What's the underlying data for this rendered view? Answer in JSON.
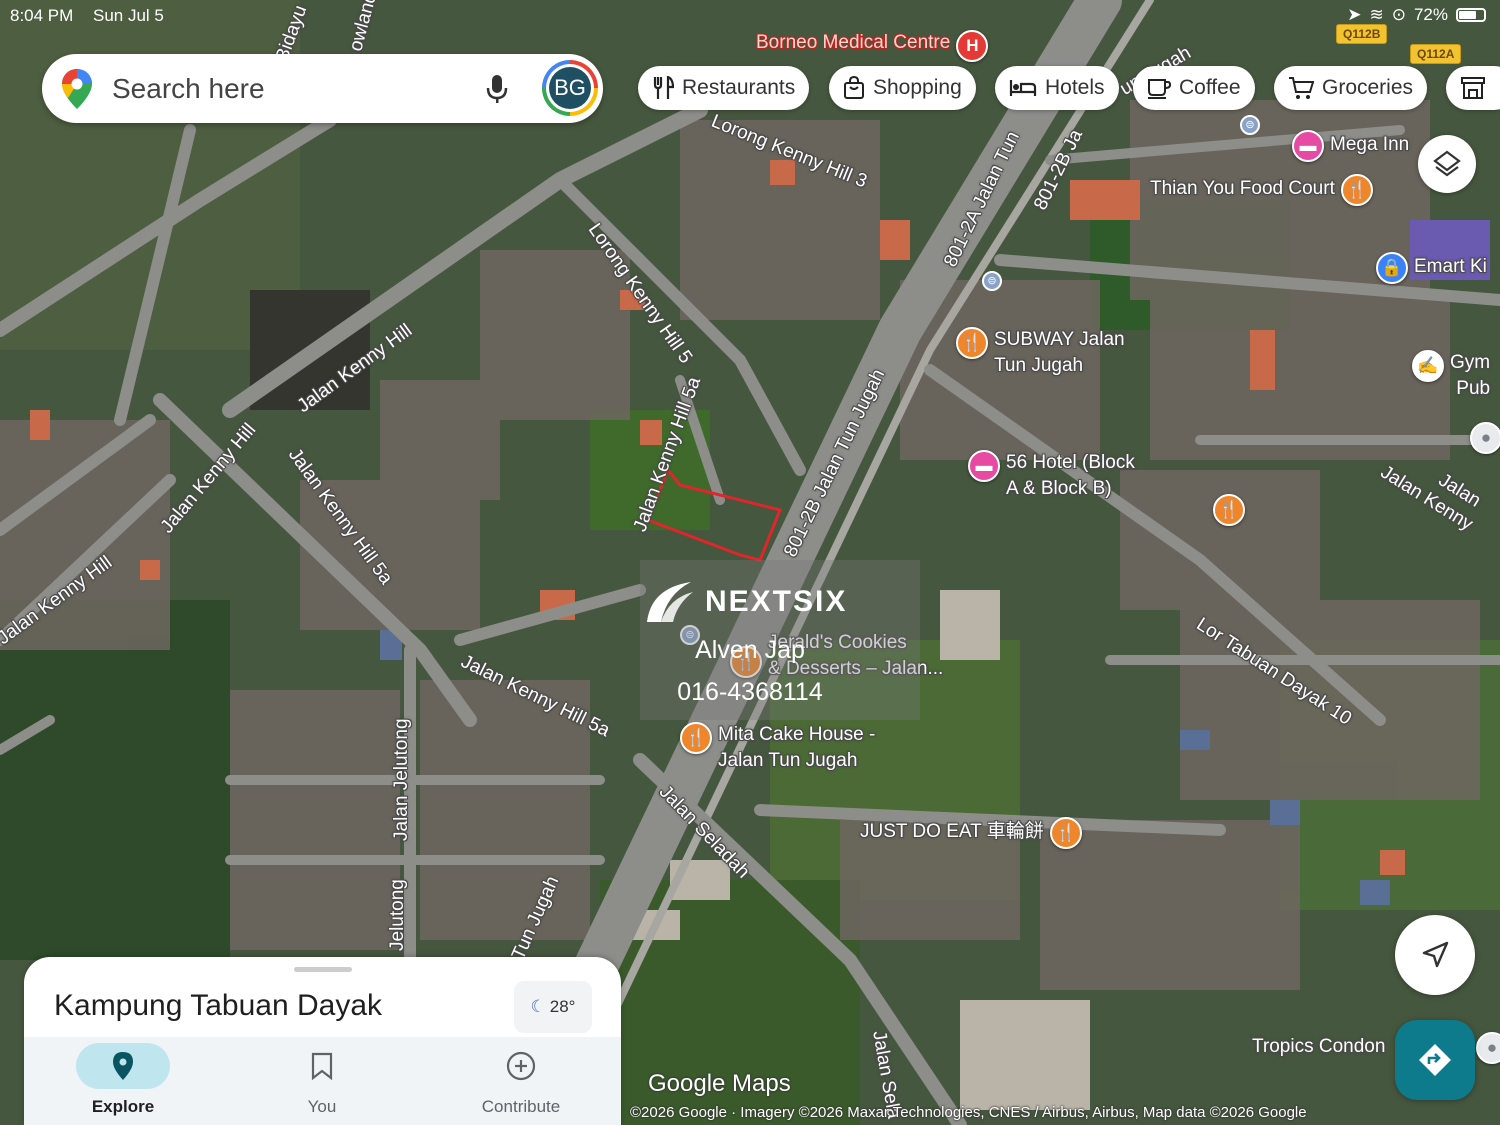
{
  "status_bar": {
    "time": "8:04 PM",
    "date": "Sun Jul 5",
    "battery": "72%"
  },
  "search": {
    "placeholder": "Search here",
    "avatar_initials": "BG"
  },
  "chips": [
    {
      "label": "Restaurants",
      "icon": "fork-knife-icon"
    },
    {
      "label": "Shopping",
      "icon": "shopping-bag-icon"
    },
    {
      "label": "Hotels",
      "icon": "bed-icon"
    },
    {
      "label": "Coffee",
      "icon": "coffee-cup-icon"
    },
    {
      "label": "Groceries",
      "icon": "cart-icon"
    }
  ],
  "map": {
    "roads": [
      "Jalan Kenny Hill",
      "Jalan Kenny Hill",
      "Jalan Kenny Hill 5a",
      "Jalan Kenny Hill 5a",
      "Lorong Kenny Hill 5",
      "Jalan Kenny Hill 5a",
      "Lorong Kenny Hill 3",
      "801-2A Jalan Tun",
      "801-2B Ja",
      "801-2B Jalan Tun Jugah",
      "Jalan Jelutong",
      "Jelutong",
      "Tun Jugah",
      "Jalan Seladah",
      "Lor Tabuan Dayak 10",
      "Jalan Kenny Hill",
      "Jalan Kenny",
      "un Jugah",
      "Jalan Sela",
      "Jalan",
      "Bidayu",
      "owland"
    ],
    "pois": [
      {
        "name": "Borneo Medical Centre",
        "type": "hospital"
      },
      {
        "name": "Mega Inn",
        "type": "hotel"
      },
      {
        "name": "Thian You Food Court",
        "type": "restaurant"
      },
      {
        "name": "Emart Ki",
        "type": "shopping"
      },
      {
        "name": "SUBWAY Jalan\nTun Jugah",
        "type": "restaurant"
      },
      {
        "name": "Gym\nPub",
        "type": "gym"
      },
      {
        "name": "56 Hotel (Block\nA & Block B)",
        "type": "hotel"
      },
      {
        "name": "Jerald's Cookies\n& Desserts – Jalan...",
        "type": "restaurant"
      },
      {
        "name": "Mita Cake House -\nJalan Tun Jugah",
        "type": "restaurant"
      },
      {
        "name": "JUST DO EAT 車輪餅",
        "type": "restaurant"
      },
      {
        "name": "Tropics Condon",
        "type": "place"
      }
    ],
    "route_badges": [
      "Q112B",
      "Q112A"
    ],
    "colors": {
      "restaurant": "#f0862b",
      "hotel": "#e64aa3",
      "hospital": "#e53935",
      "shopping": "#3b82f6",
      "parcel_outline": "#e0262a"
    }
  },
  "watermark": {
    "brand": "NEXTSIX",
    "agent": "Alven Jap",
    "phone": "016-4368114"
  },
  "sheet": {
    "title": "Kampung Tabuan Dayak",
    "temperature": "28°",
    "nav": [
      {
        "label": "Explore",
        "icon": "location-pin-icon"
      },
      {
        "label": "You",
        "icon": "bookmark-icon"
      },
      {
        "label": "Contribute",
        "icon": "add-circle-icon"
      }
    ]
  },
  "attribution": {
    "logo": "Google Maps",
    "credit": "©2026 Google · Imagery ©2026 Maxar Technologies, CNES / Airbus, Airbus, Map data ©2026 Google"
  }
}
